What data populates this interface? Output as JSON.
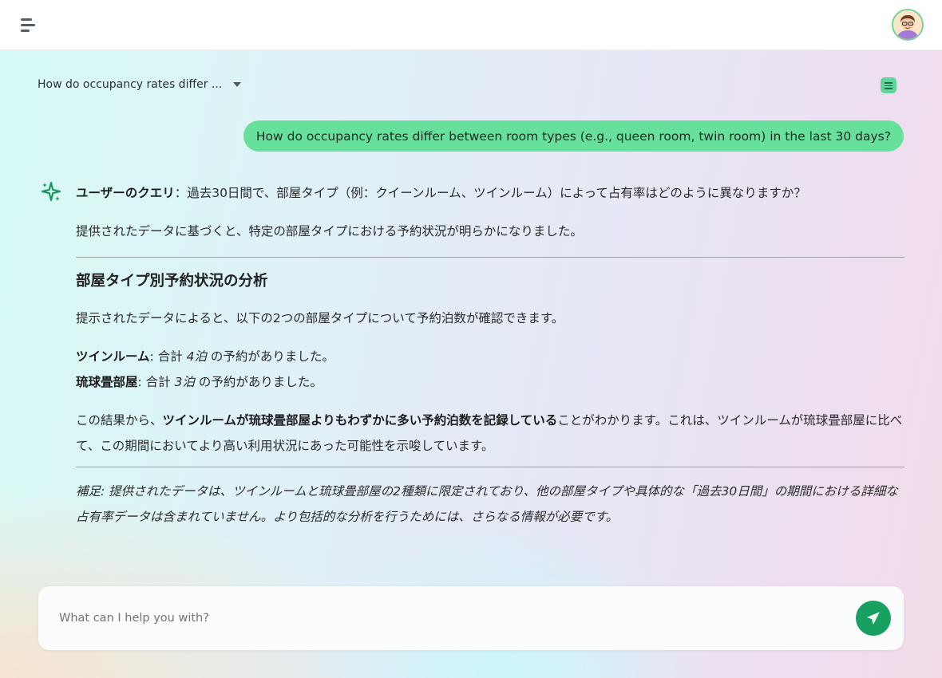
{
  "header": {
    "menu_icon": "menu-icon",
    "avatar_icon": "user-avatar"
  },
  "conversation": {
    "title": "How do occupancy rates differ ...",
    "list_icon": "list-icon"
  },
  "user_message": "How do occupancy rates differ between room types (e.g., queen room, twin room) in the last 30 days?",
  "assistant": {
    "icon": "sparkle-icon",
    "query_label": "ユーザーのクエリ",
    "query_text": "：過去30日間で、部屋タイプ（例：クイーンルーム、ツインルーム）によって占有率はどのように異なりますか？",
    "intro": "提供されたデータに基づくと、特定の部屋タイプにおける予約状況が明らかになりました。",
    "heading": "部屋タイプ別予約状況の分析",
    "para1": "提示されたデータによると、以下の2つの部屋タイプについて予約泊数が確認できます。",
    "items": [
      {
        "name": "ツインルーム",
        "pre": ": 合計 ",
        "value": "4泊",
        "post": " の予約がありました。"
      },
      {
        "name": "琉球畳部屋",
        "pre": ": 合計 ",
        "value": "3泊",
        "post": " の予約がありました。"
      }
    ],
    "conclusion_pre": "この結果から、",
    "conclusion_bold": "ツインルームが琉球畳部屋よりもわずかに多い予約泊数を記録している",
    "conclusion_post": "ことがわかります。これは、ツインルームが琉球畳部屋に比べて、この期間においてより高い利用状況にあった可能性を示唆しています。",
    "note": "補足: 提供されたデータは、ツインルームと琉球畳部屋の2種類に限定されており、他の部屋タイプや具体的な「過去30日間」の期間における詳細な占有率データは含まれていません。より包括的な分析を行うためには、さらなる情報が必要です。"
  },
  "input": {
    "placeholder": "What can I help you with?",
    "value": "",
    "send_icon": "send-icon"
  },
  "colors": {
    "accent": "#17a05f",
    "user_bubble": "#66e09a"
  }
}
